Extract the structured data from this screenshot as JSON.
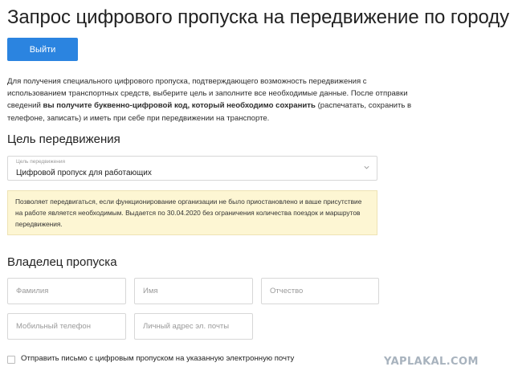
{
  "page": {
    "title": "Запрос цифрового пропуска на передвижение по городу",
    "logout_label": "Выйти"
  },
  "intro": {
    "part1": "Для получения специального цифрового пропуска, подтверждающего возможность передвижения с использованием транспортных средств, выберите цель и заполните все необходимые данные. После отправки сведений ",
    "bold": "вы получите буквенно-цифровой код, который необходимо сохранить",
    "part2": " (распечатать, сохранить в телефоне, записать) и иметь при себе при передвижении на транспорте."
  },
  "purpose": {
    "section_title": "Цель передвижения",
    "select_caption": "Цель передвижения",
    "select_value": "Цифровой пропуск для работающих",
    "chevron_icon": "chevron-down-icon",
    "note": "Позволяет передвигаться, если функционирование организации не было приостановлено и ваше присутствие на работе является необходимым. Выдается по 30.04.2020 без ограничения количества поездок и маршрутов передвижения."
  },
  "owner": {
    "section_title": "Владелец пропуска",
    "fields": {
      "surname_placeholder": "Фамилия",
      "name_placeholder": "Имя",
      "patronymic_placeholder": "Отчество",
      "phone_placeholder": "Мобильный телефон",
      "email_placeholder": "Личный адрес эл. почты"
    },
    "email_checkbox_label": "Отправить письмо с цифровым пропуском на указанную электронную почту"
  },
  "watermark": "YAPLAKAL.COM",
  "colors": {
    "primary_button": "#2b84e0",
    "note_background": "#fdf6d3",
    "field_border": "#d7d7d7"
  }
}
